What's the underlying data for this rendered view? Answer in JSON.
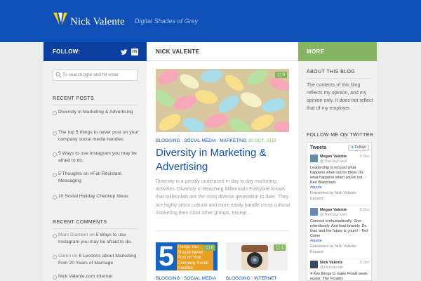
{
  "header": {
    "brand": "Nick Valente",
    "tagline": "Digital Shades of Grey"
  },
  "bars": {
    "follow": "FOLLOW:",
    "main": "NICK VALENTE",
    "more": "MORE"
  },
  "left": {
    "search_placeholder": "To search type and hit enter",
    "recent_posts_title": "RECENT POSTS",
    "recent_posts": [
      "Diversity in Marketing & Advertising",
      "The top 5 things to never post on your company social media handles",
      "5 Ways to use Instagram you may be afraid to do.",
      "5 Thoughts on #Fail Resistant Messaging",
      "10 Social Holiday Checkup Ideas"
    ],
    "recent_comments_title": "RECENT COMMENTS",
    "comments": [
      {
        "author": "Marc Diament",
        "on": "on",
        "post": "5 Ways to use Instagram you may be afraid to do."
      },
      {
        "author": "Glenn",
        "on": "on",
        "post": "6 Lessons about Marketing from 20 Years of Marriage"
      },
      {
        "author": "Nick Valente.com Internet",
        "on": "",
        "post": ""
      }
    ]
  },
  "main": {
    "hero_comments": "0",
    "categories": [
      "BLOGGING",
      "SOCIAL MEDIA",
      "MARKETING"
    ],
    "date": "30 OCT, 2015",
    "title": "Diversity in Marketing & Advertising",
    "excerpt": "Diversity is a greatly underused in day to day marketing activities.  Diversity in Reaching Millennials Everyone knows that millennials are the most diverse generation to date. They are highly cross cultural and more easily handle cross cultural marketing then most other groups, except…",
    "thumb1": {
      "number": "5",
      "caption": "Things You Should Never Post on Your Company Social Handles",
      "comments": "0",
      "cats": [
        "BLOGGING",
        "SOCIAL MEDIA"
      ]
    },
    "thumb2": {
      "comments": "1",
      "cats": [
        "BLOGGING",
        "INTERNET"
      ]
    }
  },
  "right": {
    "about_title": "ABOUT THIS BLOG",
    "about_text": "The contents of this blog reflects my opinion, and my opinion only. It does not reflect that of my employer.",
    "twitter_title": "FOLLOW ME ON TWITTER",
    "twitter_head": "Tweets",
    "twitter_follow": "Follow",
    "tweets": [
      {
        "name": "Megan Valente",
        "handle": "@TheDayLived",
        "date": "3 Dec",
        "text": "Leadership is not just what happens when you're there, it's what happens when you're not. - Ken Blanchard",
        "tag": "#quote",
        "foot": "Retweeted by Nick Valente",
        "expand": "Expand"
      },
      {
        "name": "Megan Valente",
        "handle": "@TheDayLived",
        "date": "8 Dec",
        "text": "Connect enthusiastically. Give relentlessly. And lead bravely. Do that, and the future is yours! - Ted Coine",
        "tag": "#quote",
        "foot": "Retweeted by Nick Valente",
        "expand": "Expand"
      },
      {
        "name": "Nick Valente",
        "handle": "@nickvalente",
        "date": "5 Dec",
        "text": "4 Key things to make Finals week easier. The Finalle)",
        "tag": "",
        "foot": "",
        "expand": ""
      }
    ]
  },
  "colors": {
    "header_blue": "#0e50b8",
    "follow_blue": "#0c40a0",
    "accent_green": "#86b463"
  },
  "icons": [
    "logo-mark-icon",
    "twitter-icon",
    "linkedin-icon",
    "search-icon",
    "comment-bubble-icon"
  ]
}
